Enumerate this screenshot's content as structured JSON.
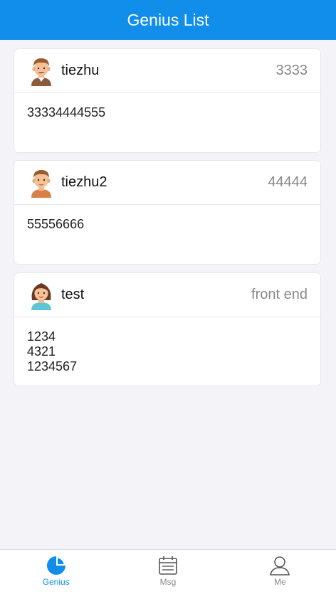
{
  "navbar": {
    "title": "Genius List"
  },
  "cards": [
    {
      "name": "tiezhu",
      "extra": "3333",
      "avatar": "boy-avatar-icon",
      "lines": [
        "33334444555"
      ]
    },
    {
      "name": "tiezhu2",
      "extra": "44444",
      "avatar": "boy-avatar-icon",
      "lines": [
        "55556666"
      ]
    },
    {
      "name": "test",
      "extra": "front end",
      "avatar": "girl-avatar-icon",
      "lines": [
        "1234",
        "4321",
        "1234567"
      ]
    }
  ],
  "tabbar": {
    "items": [
      {
        "label": "Genius",
        "icon": "pie-chart-icon",
        "active": true
      },
      {
        "label": "Msg",
        "icon": "calendar-icon",
        "active": false
      },
      {
        "label": "Me",
        "icon": "user-icon",
        "active": false
      }
    ]
  },
  "colors": {
    "primary": "#108ee9",
    "background": "#f3f3f8",
    "muted": "#888888"
  }
}
